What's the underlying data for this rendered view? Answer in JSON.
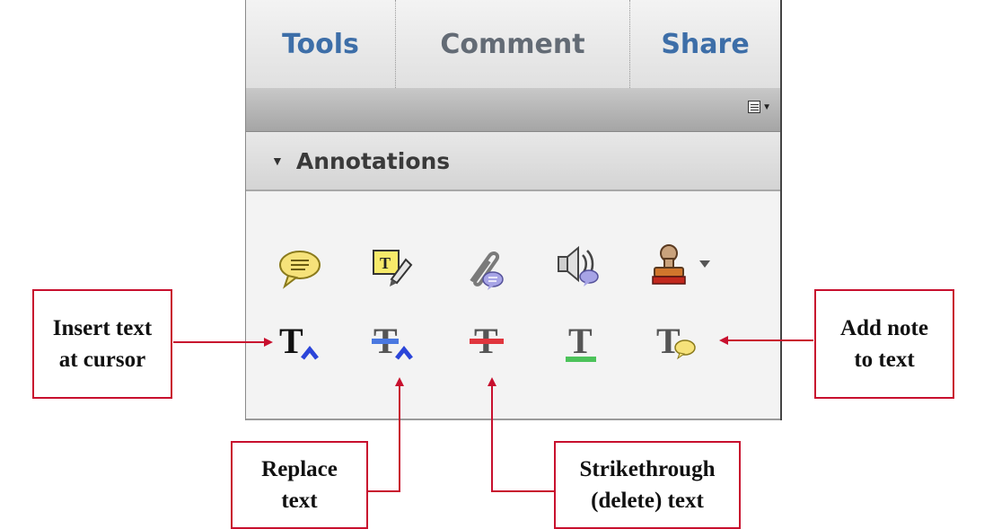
{
  "tabs": [
    {
      "label": "Tools"
    },
    {
      "label": "Comment"
    },
    {
      "label": "Share"
    }
  ],
  "toolbar": {
    "options_icon": "panel-options-icon"
  },
  "section": {
    "title": "Annotations",
    "icon": "collapse-triangle-icon"
  },
  "annotations_row1": [
    {
      "icon": "sticky-note-icon"
    },
    {
      "icon": "text-box-note-icon"
    },
    {
      "icon": "attach-file-icon"
    },
    {
      "icon": "record-audio-icon"
    },
    {
      "icon": "stamp-icon"
    }
  ],
  "annotations_row2": [
    {
      "icon": "insert-text-icon"
    },
    {
      "icon": "replace-text-icon"
    },
    {
      "icon": "strikethrough-text-icon"
    },
    {
      "icon": "underline-text-icon"
    },
    {
      "icon": "add-note-to-text-icon"
    }
  ],
  "callouts": {
    "insert": "Insert text\nat cursor",
    "replace": "Replace\ntext",
    "strike": "Strikethrough\n(delete) text",
    "note": "Add note\nto text"
  },
  "colors": {
    "callout_border": "#c8102e",
    "tab_blue": "#3d6ea8",
    "tab_gray": "#636b75"
  }
}
